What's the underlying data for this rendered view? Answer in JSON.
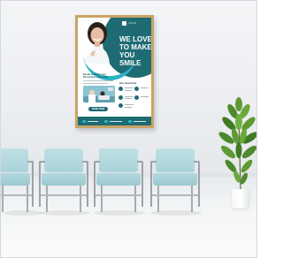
{
  "poster": {
    "brand_name": "LOGO",
    "headline_line1": "WE LOVE",
    "headline_line2": "TO MAKE",
    "headline_line3": "YOU SMILE",
    "sub_heading": "Dental Aesthetic and Restorative since 2000",
    "specialty_title": "Our Specialty",
    "button_label": "BOOK NOW"
  },
  "colors": {
    "poster_teal": "#1f6b73",
    "poster_cyan": "#29b3c3",
    "frame_wood": "#c9a366",
    "chair_fabric": "#a9d3d9",
    "plant_green": "#4f8a2e"
  },
  "icons": [
    "tooth-logo-icon",
    "specialty-icon",
    "phone-icon",
    "mail-icon",
    "web-icon"
  ]
}
